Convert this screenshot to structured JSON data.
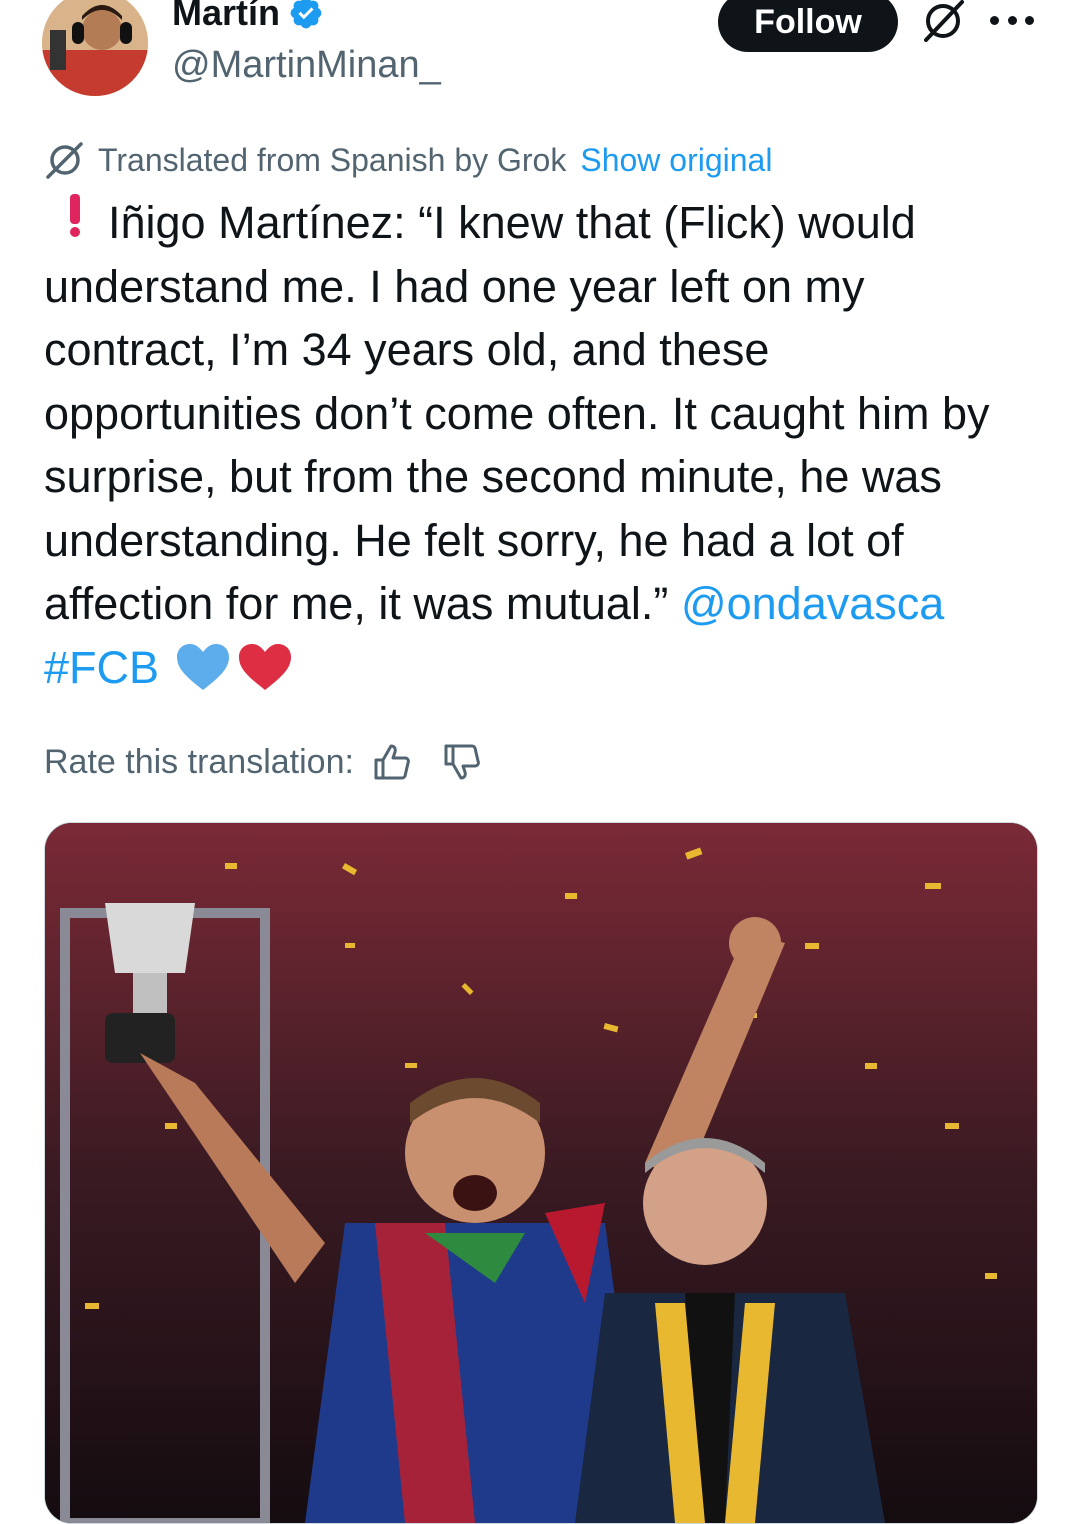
{
  "author": {
    "display_name": "Martín",
    "handle": "@MartinMinan_",
    "verified_icon": "verified-badge-icon",
    "avatar_icon": "avatar"
  },
  "actions": {
    "follow_label": "Follow",
    "grok_icon": "grok-icon",
    "more_icon": "more-options-icon"
  },
  "translation": {
    "notice": "Translated from Spanish by Grok",
    "show_original": "Show original",
    "rate_label": "Rate this translation:",
    "thumbs_up_icon": "thumbs-up-icon",
    "thumbs_down_icon": "thumbs-down-icon"
  },
  "tweet": {
    "line1": "Iñigo Martínez: “I knew that (Flick) would",
    "line2": "understand me. I had one year left on my",
    "line3": "contract, I’m 34 years old, and these",
    "line4": "opportunities don’t come often. It caught him by",
    "line5": "surprise, but from the second minute, he was",
    "line6": "understanding. He felt sorry, he had a lot of",
    "line7": "affection for me, it was mutual.”",
    "mention": "@ondavasca",
    "hashtag": "#FCB",
    "emojis": [
      "red-exclamation",
      "blue-heart",
      "red-heart"
    ]
  },
  "colors": {
    "link": "#1d9bf0",
    "text": "#0f1419",
    "secondary": "#536471",
    "follow_bg": "#0f1419"
  }
}
